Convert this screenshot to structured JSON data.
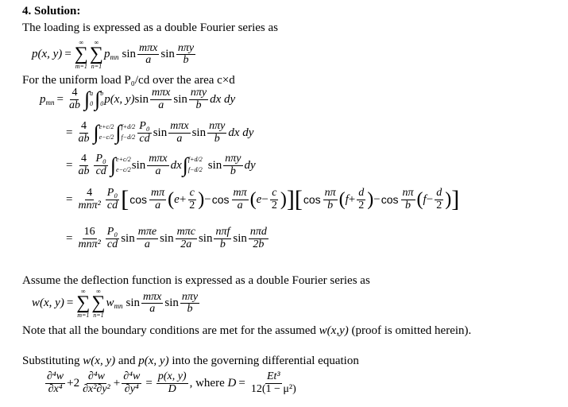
{
  "heading": "4. Solution:",
  "paragraphs": {
    "intro": "The loading is expressed as a double Fourier series as",
    "uniform_load": "For the uniform load P₀/cd over the area c×d",
    "assume_deflection": "Assume the deflection function is expressed as a double Fourier series as",
    "note_prefix": "Note that all the boundary conditions are met for the assumed ",
    "note_var": "w(x,y)",
    "note_suffix": " (proof is omitted herein).",
    "substituting_prefix": "Substituting ",
    "substituting_w": "w(x, y)",
    "substituting_and": " and ",
    "substituting_p": "p(x, y)",
    "substituting_suffix": " into the governing differential equation"
  },
  "symbols": {
    "p_xy": "p(x, y)",
    "w_xy": "w(x, y)",
    "equals": "=",
    "minus": "−",
    "plus": "+",
    "inf": "∞",
    "m1": "m=1",
    "n1": "n=1",
    "sigma": "∑",
    "integral": "∫",
    "p_mn_base": "p",
    "w_mn_base": "w",
    "mn": "mn",
    "sin": "sin",
    "cos": "cos",
    "m_pi_x": "mπx",
    "n_pi_y": "nπy",
    "a": "a",
    "b": "b",
    "four": "4",
    "sixteen": "16",
    "ab": "ab",
    "P0": "P₀",
    "cd": "cd",
    "dxdy": "dx dy",
    "dx": "dx",
    "dy": "dy",
    "zero": "0",
    "e_plus_c2": "e+c/2",
    "e_minus_c2": "e−c/2",
    "f_plus_d2": "f+d/2",
    "f_minus_d2": "f−d/2",
    "mn_pi2": "mnπ²",
    "m_pi": "mπ",
    "n_pi": "nπ",
    "e": "e",
    "f": "f",
    "c": "c",
    "d": "d",
    "two": "2",
    "m_pi_e": "mπe",
    "m_pi_c": "mπc",
    "n_pi_f": "nπf",
    "n_pi_d": "nπd",
    "two_a": "2a",
    "two_b": "2b",
    "d4w": "∂⁴w",
    "dx4": "∂x⁴",
    "dx2dy2": "∂x²∂y²",
    "dy4": "∂y⁴",
    "two_coef": "2",
    "D": "D",
    "where": ", where ",
    "Et3": "Et³",
    "twelve_1_mu2": "12(1 − μ²)",
    "lparen": "(",
    "rparen": ")",
    "lbrack": "[",
    "rbrack": "]"
  }
}
